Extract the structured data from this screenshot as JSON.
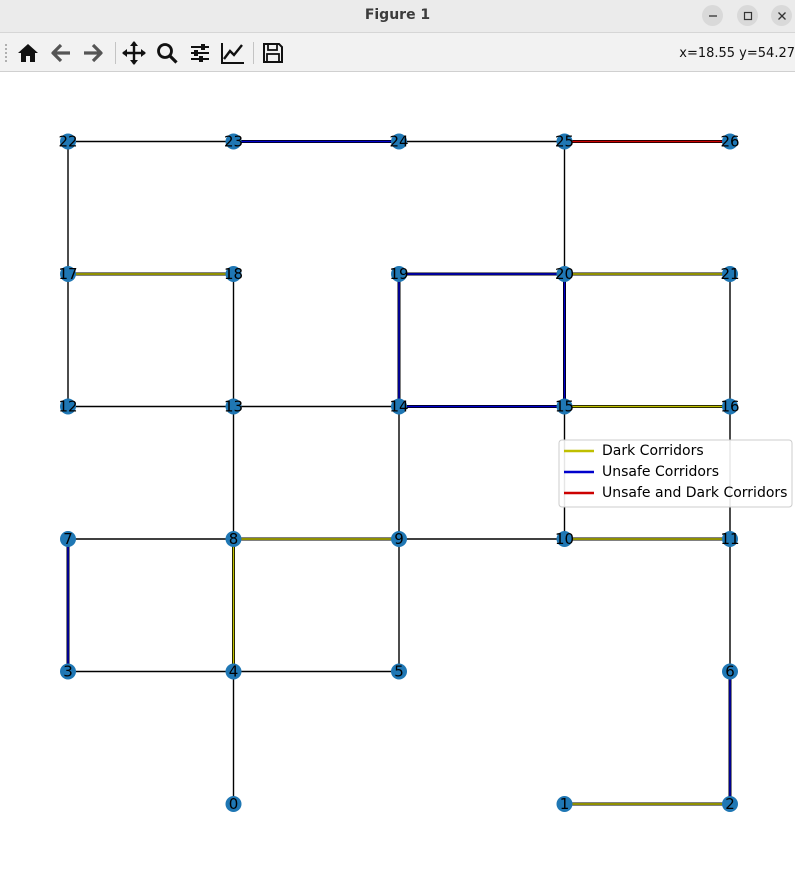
{
  "window": {
    "title": "Figure 1",
    "minimize_label": "–",
    "maximize_label": "□",
    "close_label": "×"
  },
  "toolbar": {
    "buttons": [
      {
        "name": "home-icon"
      },
      {
        "name": "back-icon"
      },
      {
        "name": "forward-icon"
      },
      {
        "name": "pan-icon"
      },
      {
        "name": "zoom-icon"
      },
      {
        "name": "configure-subplots-icon"
      },
      {
        "name": "edit-axis-icon"
      },
      {
        "name": "save-icon"
      }
    ],
    "coords": "x=18.55 y=54.27"
  },
  "colors": {
    "edge": "#000000",
    "dark": "#bfbf00",
    "unsafe": "#0000cc",
    "unsafe_dark": "#cc0000",
    "node": "#1f77b4",
    "background": "#ffffff"
  },
  "chart_data": {
    "type": "graph",
    "nodes": [
      {
        "id": "0",
        "x": 1,
        "y": 0
      },
      {
        "id": "1",
        "x": 3,
        "y": 0
      },
      {
        "id": "2",
        "x": 4,
        "y": 0
      },
      {
        "id": "3",
        "x": 0,
        "y": 1
      },
      {
        "id": "4",
        "x": 1,
        "y": 1
      },
      {
        "id": "5",
        "x": 2,
        "y": 1
      },
      {
        "id": "6",
        "x": 4,
        "y": 1
      },
      {
        "id": "7",
        "x": 0,
        "y": 2
      },
      {
        "id": "8",
        "x": 1,
        "y": 2
      },
      {
        "id": "9",
        "x": 2,
        "y": 2
      },
      {
        "id": "10",
        "x": 3,
        "y": 2
      },
      {
        "id": "11",
        "x": 4,
        "y": 2
      },
      {
        "id": "12",
        "x": 0,
        "y": 3
      },
      {
        "id": "13",
        "x": 1,
        "y": 3
      },
      {
        "id": "14",
        "x": 2,
        "y": 3
      },
      {
        "id": "15",
        "x": 3,
        "y": 3
      },
      {
        "id": "16",
        "x": 4,
        "y": 3
      },
      {
        "id": "17",
        "x": 0,
        "y": 4
      },
      {
        "id": "18",
        "x": 1,
        "y": 4
      },
      {
        "id": "19",
        "x": 2,
        "y": 4
      },
      {
        "id": "20",
        "x": 3,
        "y": 4
      },
      {
        "id": "21",
        "x": 4,
        "y": 4
      },
      {
        "id": "22",
        "x": 0,
        "y": 5
      },
      {
        "id": "23",
        "x": 1,
        "y": 5
      },
      {
        "id": "24",
        "x": 2,
        "y": 5
      },
      {
        "id": "25",
        "x": 3,
        "y": 5
      },
      {
        "id": "26",
        "x": 4,
        "y": 5
      }
    ],
    "edges": [
      {
        "from": "0",
        "to": "4",
        "kind": "normal"
      },
      {
        "from": "1",
        "to": "2",
        "kind": "dark"
      },
      {
        "from": "2",
        "to": "6",
        "kind": "unsafe"
      },
      {
        "from": "3",
        "to": "4",
        "kind": "normal"
      },
      {
        "from": "3",
        "to": "7",
        "kind": "unsafe"
      },
      {
        "from": "4",
        "to": "5",
        "kind": "normal"
      },
      {
        "from": "4",
        "to": "8",
        "kind": "dark"
      },
      {
        "from": "5",
        "to": "9",
        "kind": "normal"
      },
      {
        "from": "6",
        "to": "11",
        "kind": "normal"
      },
      {
        "from": "7",
        "to": "8",
        "kind": "normal"
      },
      {
        "from": "8",
        "to": "9",
        "kind": "dark"
      },
      {
        "from": "8",
        "to": "13",
        "kind": "normal"
      },
      {
        "from": "9",
        "to": "10",
        "kind": "normal"
      },
      {
        "from": "9",
        "to": "14",
        "kind": "normal"
      },
      {
        "from": "10",
        "to": "11",
        "kind": "dark"
      },
      {
        "from": "10",
        "to": "15",
        "kind": "normal"
      },
      {
        "from": "11",
        "to": "16",
        "kind": "normal"
      },
      {
        "from": "12",
        "to": "13",
        "kind": "normal"
      },
      {
        "from": "12",
        "to": "17",
        "kind": "normal"
      },
      {
        "from": "13",
        "to": "14",
        "kind": "normal"
      },
      {
        "from": "13",
        "to": "18",
        "kind": "normal"
      },
      {
        "from": "14",
        "to": "15",
        "kind": "unsafe"
      },
      {
        "from": "14",
        "to": "19",
        "kind": "unsafe"
      },
      {
        "from": "15",
        "to": "16",
        "kind": "dark"
      },
      {
        "from": "15",
        "to": "20",
        "kind": "unsafe"
      },
      {
        "from": "16",
        "to": "21",
        "kind": "normal"
      },
      {
        "from": "17",
        "to": "18",
        "kind": "dark"
      },
      {
        "from": "17",
        "to": "22",
        "kind": "normal"
      },
      {
        "from": "19",
        "to": "20",
        "kind": "unsafe"
      },
      {
        "from": "20",
        "to": "21",
        "kind": "dark"
      },
      {
        "from": "20",
        "to": "25",
        "kind": "normal"
      },
      {
        "from": "22",
        "to": "23",
        "kind": "normal"
      },
      {
        "from": "23",
        "to": "24",
        "kind": "unsafe"
      },
      {
        "from": "24",
        "to": "25",
        "kind": "normal"
      },
      {
        "from": "25",
        "to": "26",
        "kind": "unsafe_dark"
      }
    ],
    "legend": [
      {
        "label": "Dark Corridors",
        "kind": "dark"
      },
      {
        "label": "Unsafe Corridors",
        "kind": "unsafe"
      },
      {
        "label": "Unsafe and Dark Corridors",
        "kind": "unsafe_dark"
      }
    ],
    "legend_position": "right",
    "axes_visible": false
  }
}
